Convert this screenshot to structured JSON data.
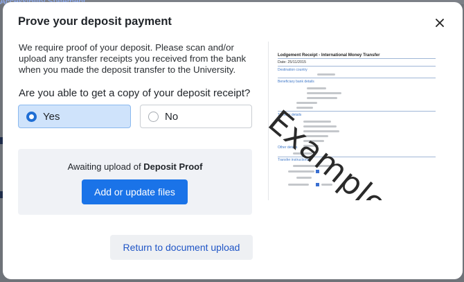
{
  "background": {
    "link_fragment": "Accessibility Statement"
  },
  "dialog": {
    "title": "Prove your deposit payment",
    "intro": "We require proof of your deposit. Please scan and/or upload any transfer receipts you received from the bank when you made the deposit transfer to the University.",
    "question": "Are you able to get a copy of your deposit receipt?",
    "options": [
      {
        "label": "Yes",
        "selected": true
      },
      {
        "label": "No",
        "selected": false
      }
    ],
    "upload": {
      "status_prefix": "Awaiting upload of",
      "status_item": "Deposit Proof",
      "button_label": "Add or update files"
    },
    "return_label": "Return to document upload",
    "icons": {
      "close": "close-icon"
    }
  },
  "example_image": {
    "receipt_title": "Lodgement Receipt - International Money Transfer",
    "receipt_date": "Date: 25/11/2015",
    "sections": [
      "Destination country",
      "Beneficiary bank details",
      "Transfer details",
      "Other details",
      "Transfer instructions"
    ],
    "watermark": "Example"
  },
  "colors": {
    "primary": "#1a73e8",
    "selected_bg": "#cfe3fb",
    "link": "#1f55c6"
  }
}
